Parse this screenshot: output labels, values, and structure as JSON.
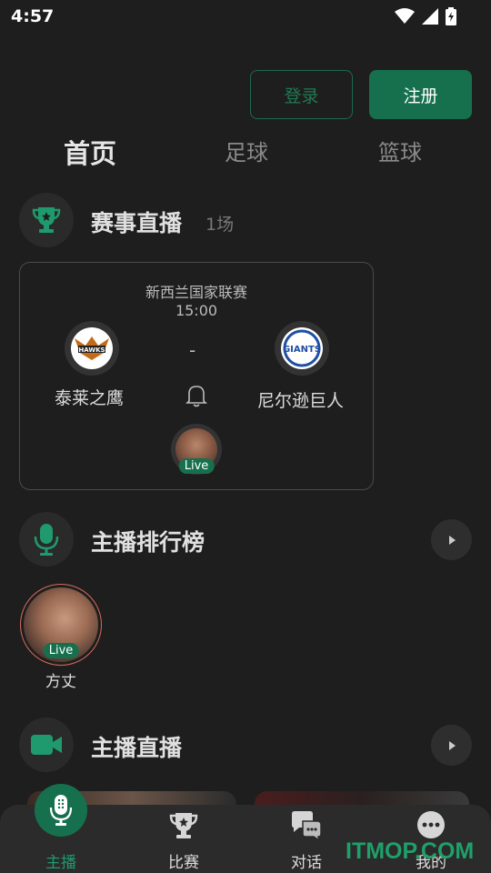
{
  "status": {
    "time": "4:57"
  },
  "auth": {
    "login_label": "登录",
    "register_label": "注册"
  },
  "tabs": [
    {
      "label": "首页"
    },
    {
      "label": "足球"
    },
    {
      "label": "篮球"
    }
  ],
  "live_section": {
    "title": "赛事直播",
    "count": "1场"
  },
  "match": {
    "league": "新西兰国家联赛",
    "time": "15:00",
    "score": "-",
    "home": {
      "name": "泰莱之鹰",
      "logo_text": "HAWKS"
    },
    "away": {
      "name": "尼尔逊巨人",
      "logo_text": "GIANTS"
    },
    "live_label": "Live"
  },
  "ranking_section": {
    "title": "主播排行榜"
  },
  "anchors": [
    {
      "name": "方丈",
      "live_label": "Live"
    }
  ],
  "streams_section": {
    "title": "主播直播"
  },
  "bottom_nav": [
    {
      "label": "主播"
    },
    {
      "label": "比赛"
    },
    {
      "label": "对话"
    },
    {
      "label": "我的"
    }
  ],
  "colors": {
    "accent": "#16704e",
    "background": "#1e1e1e"
  },
  "watermark": "ITMOP.COM"
}
